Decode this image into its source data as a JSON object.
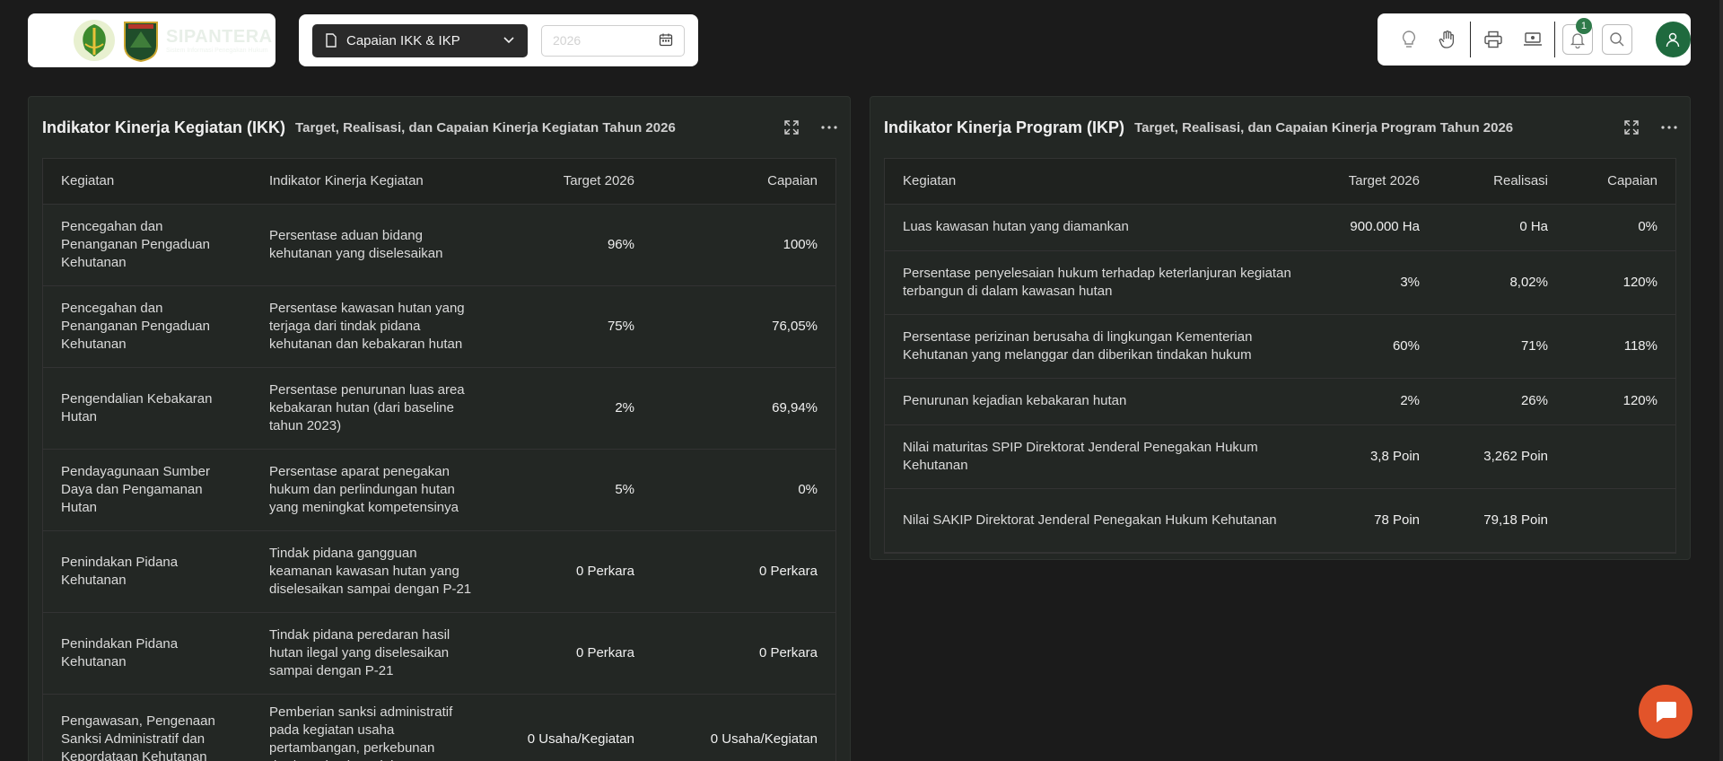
{
  "brand": {
    "name": "SIPANTERA",
    "subtitle": "Sistem Informasi Penegakan Hukum"
  },
  "filter": {
    "select_label": "Capaian IKK & IKP",
    "year_placeholder": "2026"
  },
  "toolbar": {
    "notification_count": "1",
    "icons": [
      "lightbulb-icon",
      "hand-icon",
      "printer-icon",
      "presentation-icon",
      "bell-icon",
      "search-icon",
      "user-icon"
    ]
  },
  "ikk": {
    "title": "Indikator Kinerja Kegiatan (IKK)",
    "subtitle": "Target, Realisasi, dan Capaian Kinerja Kegiatan Tahun 2026",
    "headers": [
      "Kegiatan",
      "Indikator Kinerja Kegiatan",
      "Target 2026",
      "Capaian"
    ],
    "rows": [
      [
        "Pencegahan dan Penanganan Pengaduan Kehutanan",
        "Persentase aduan bidang kehutanan yang diselesaikan",
        "96%",
        "100%"
      ],
      [
        "Pencegahan dan Penanganan Pengaduan Kehutanan",
        "Persentase kawasan hutan yang terjaga dari tindak pidana kehutanan dan kebakaran hutan",
        "75%",
        "76,05%"
      ],
      [
        "Pengendalian Kebakaran Hutan",
        "Persentase penurunan luas area kebakaran hutan (dari baseline tahun 2023)",
        "2%",
        "69,94%"
      ],
      [
        "Pendayagunaan Sumber Daya dan Pengamanan Hutan",
        "Persentase aparat penegakan hukum dan perlindungan hutan yang meningkat kompetensinya",
        "5%",
        "0%"
      ],
      [
        "Penindakan Pidana Kehutanan",
        "Tindak pidana gangguan keamanan kawasan hutan yang diselesaikan sampai dengan P-21",
        "0 Perkara",
        "0 Perkara"
      ],
      [
        "Penindakan Pidana Kehutanan",
        "Tindak pidana peredaran hasil hutan ilegal yang diselesaikan sampai dengan P-21",
        "0 Perkara",
        "0 Perkara"
      ],
      [
        "Pengawasan, Pengenaan Sanksi Administratif dan Kepordataan Kehutanan",
        "Pemberian sanksi administratif pada kegiatan usaha pertambangan, perkebunan dan/atau kegiatan lain",
        "0 Usaha/Kegiatan",
        "0 Usaha/Kegiatan"
      ]
    ]
  },
  "ikp": {
    "title": "Indikator Kinerja Program (IKP)",
    "subtitle": "Target, Realisasi, dan Capaian Kinerja Program Tahun 2026",
    "headers": [
      "Kegiatan",
      "Target 2026",
      "Realisasi",
      "Capaian"
    ],
    "rows": [
      [
        "Luas kawasan hutan yang diamankan",
        "900.000 Ha",
        "0 Ha",
        "0%"
      ],
      [
        "Persentase penyelesaian hukum terhadap keterlanjuran kegiatan terbangun di dalam kawasan hutan",
        "3%",
        "8,02%",
        "120%"
      ],
      [
        "Persentase perizinan berusaha di lingkungan Kementerian Kehutanan yang melanggar dan diberikan tindakan hukum",
        "60%",
        "71%",
        "118%"
      ],
      [
        "Penurunan kejadian kebakaran hutan",
        "2%",
        "26%",
        "120%"
      ],
      [
        "Nilai maturitas SPIP Direktorat Jenderal Penegakan Hukum Kehutanan",
        "3,8 Poin",
        "3,262 Poin",
        ""
      ],
      [
        "Nilai SAKIP Direktorat Jenderal Penegakan Hukum Kehutanan",
        "78 Poin",
        "79,18 Poin",
        ""
      ]
    ]
  }
}
